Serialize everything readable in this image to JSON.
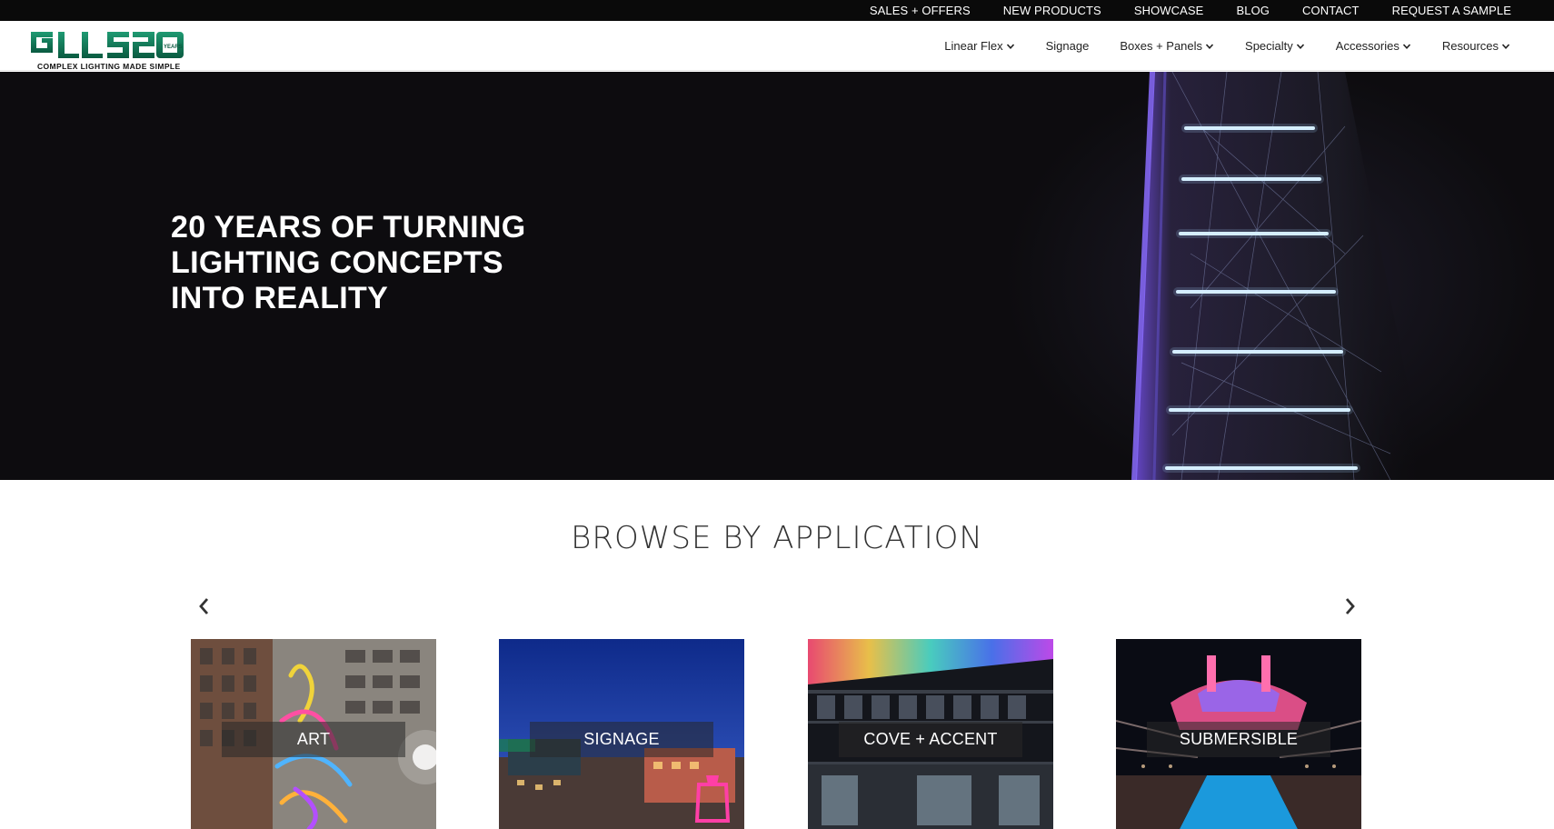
{
  "topbar": {
    "links": [
      "SALES + OFFERS",
      "NEW PRODUCTS",
      "SHOWCASE",
      "BLOG",
      "CONTACT",
      "REQUEST A SAMPLE"
    ]
  },
  "header": {
    "logo_text": "GLLS20",
    "logo_badge": "YEARS",
    "tagline": "COMPLEX LIGHTING MADE SIMPLE",
    "nav": [
      {
        "label": "Linear Flex",
        "dropdown": true
      },
      {
        "label": "Signage",
        "dropdown": false
      },
      {
        "label": "Boxes + Panels",
        "dropdown": true
      },
      {
        "label": "Specialty",
        "dropdown": true
      },
      {
        "label": "Accessories",
        "dropdown": true
      },
      {
        "label": "Resources",
        "dropdown": true
      }
    ]
  },
  "hero": {
    "line1": "20 YEARS OF TURNING",
    "line2": "LIGHTING CONCEPTS",
    "line3": "INTO REALITY"
  },
  "browse": {
    "title": "BROWSE BY APPLICATION",
    "prev_icon": "chevron-left-icon",
    "next_icon": "chevron-right-icon",
    "cards": [
      {
        "label": "ART"
      },
      {
        "label": "SIGNAGE"
      },
      {
        "label": "COVE + ACCENT"
      },
      {
        "label": "SUBMERSIBLE"
      }
    ]
  },
  "colors": {
    "brand_green": "#0f6b4f",
    "topbar_bg": "#0a0a0a",
    "hero_bg": "#0d0c0f"
  }
}
